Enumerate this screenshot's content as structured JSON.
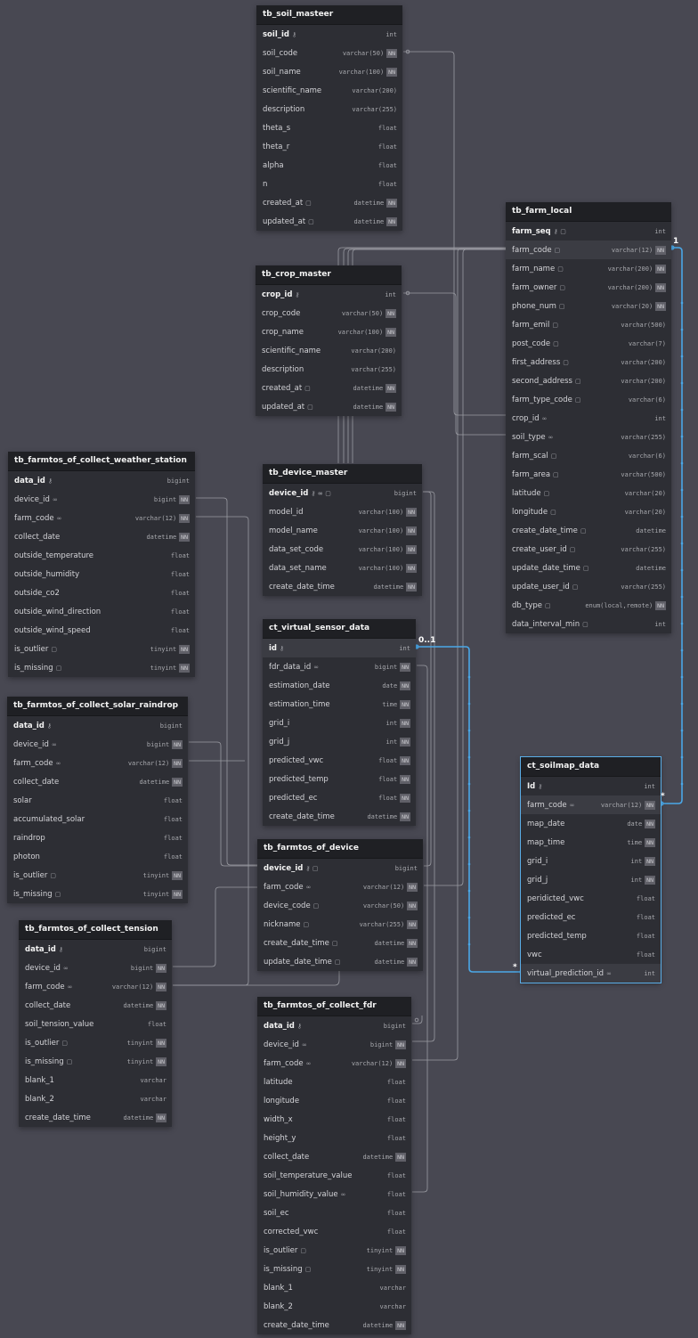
{
  "tables": [
    {
      "id": "tb_soil_masteer",
      "name": "tb_soil_masteer",
      "cols": [
        {
          "n": "soil_id",
          "t": "int",
          "pk": true,
          "ic": "key-icon"
        },
        {
          "n": "soil_code",
          "t": "varchar(50)",
          "nn": true
        },
        {
          "n": "soil_name",
          "t": "varchar(100)",
          "nn": true
        },
        {
          "n": "scientific_name",
          "t": "varchar(200)"
        },
        {
          "n": "description",
          "t": "varchar(255)"
        },
        {
          "n": "theta_s",
          "t": "float"
        },
        {
          "n": "theta_r",
          "t": "float"
        },
        {
          "n": "alpha",
          "t": "float"
        },
        {
          "n": "n",
          "t": "float"
        },
        {
          "n": "created_at",
          "t": "datetime",
          "nn": true,
          "ic": "note-icon"
        },
        {
          "n": "updated_at",
          "t": "datetime",
          "nn": true,
          "ic": "note-icon"
        }
      ]
    },
    {
      "id": "tb_crop_master",
      "name": "tb_crop_master",
      "cols": [
        {
          "n": "crop_id",
          "t": "int",
          "pk": true,
          "ic": "key-icon"
        },
        {
          "n": "crop_code",
          "t": "varchar(50)",
          "nn": true
        },
        {
          "n": "crop_name",
          "t": "varchar(100)",
          "nn": true
        },
        {
          "n": "scientific_name",
          "t": "varchar(200)"
        },
        {
          "n": "description",
          "t": "varchar(255)"
        },
        {
          "n": "created_at",
          "t": "datetime",
          "nn": true,
          "ic": "note-icon"
        },
        {
          "n": "updated_at",
          "t": "datetime",
          "nn": true,
          "ic": "note-icon"
        }
      ]
    },
    {
      "id": "tb_farm_local",
      "name": "tb_farm_local",
      "cols": [
        {
          "n": "farm_seq",
          "t": "int",
          "pk": true,
          "ic": "key-note-icon"
        },
        {
          "n": "farm_code",
          "t": "varchar(12)",
          "nn": true,
          "ic": "note-icon",
          "hi": true
        },
        {
          "n": "farm_name",
          "t": "varchar(200)",
          "nn": true,
          "ic": "note-icon"
        },
        {
          "n": "farm_owner",
          "t": "varchar(200)",
          "nn": true,
          "ic": "note-icon"
        },
        {
          "n": "phone_num",
          "t": "varchar(20)",
          "nn": true,
          "ic": "note-icon"
        },
        {
          "n": "farm_emil",
          "t": "varchar(500)",
          "ic": "note-icon"
        },
        {
          "n": "post_code",
          "t": "varchar(7)",
          "ic": "note-icon"
        },
        {
          "n": "first_address",
          "t": "varchar(200)",
          "ic": "note-icon"
        },
        {
          "n": "second_address",
          "t": "varchar(200)",
          "ic": "note-icon"
        },
        {
          "n": "farm_type_code",
          "t": "varchar(6)",
          "ic": "note-icon"
        },
        {
          "n": "crop_id",
          "t": "int",
          "ic": "link-icon"
        },
        {
          "n": "soil_type",
          "t": "varchar(255)",
          "ic": "link-icon"
        },
        {
          "n": "farm_scal",
          "t": "varchar(6)",
          "ic": "note-icon"
        },
        {
          "n": "farm_area",
          "t": "varchar(500)",
          "ic": "note-icon"
        },
        {
          "n": "latitude",
          "t": "varchar(20)",
          "ic": "note-icon"
        },
        {
          "n": "longitude",
          "t": "varchar(20)",
          "ic": "note-icon"
        },
        {
          "n": "create_date_time",
          "t": "datetime",
          "ic": "note-icon"
        },
        {
          "n": "create_user_id",
          "t": "varchar(255)",
          "ic": "note-icon"
        },
        {
          "n": "update_date_time",
          "t": "datetime",
          "ic": "note-icon"
        },
        {
          "n": "update_user_id",
          "t": "varchar(255)",
          "ic": "note-icon"
        },
        {
          "n": "db_type",
          "t": "enum(local,remote)",
          "nn": true,
          "ic": "note-icon"
        },
        {
          "n": "data_interval_min",
          "t": "int",
          "ic": "note-icon"
        }
      ]
    },
    {
      "id": "tb_farmtos_of_collect_weather_station",
      "name": "tb_farmtos_of_collect_weather_station",
      "cols": [
        {
          "n": "data_id",
          "t": "bigint",
          "pk": true,
          "ic": "key-icon"
        },
        {
          "n": "device_id",
          "t": "bigint",
          "nn": true,
          "ic": "link-icon"
        },
        {
          "n": "farm_code",
          "t": "varchar(12)",
          "nn": true,
          "ic": "link-icon"
        },
        {
          "n": "collect_date",
          "t": "datetime",
          "nn": true
        },
        {
          "n": "outside_temperature",
          "t": "float"
        },
        {
          "n": "outside_humidity",
          "t": "float"
        },
        {
          "n": "outside_co2",
          "t": "float"
        },
        {
          "n": "outside_wind_direction",
          "t": "float"
        },
        {
          "n": "outside_wind_speed",
          "t": "float"
        },
        {
          "n": "is_outlier",
          "t": "tinyint",
          "nn": true,
          "ic": "note-icon"
        },
        {
          "n": "is_missing",
          "t": "tinyint",
          "nn": true,
          "ic": "note-icon"
        }
      ]
    },
    {
      "id": "tb_device_master",
      "name": "tb_device_master",
      "cols": [
        {
          "n": "device_id",
          "t": "bigint",
          "pk": true,
          "ic": "key-link-note-icon"
        },
        {
          "n": "model_id",
          "t": "varchar(100)",
          "nn": true
        },
        {
          "n": "model_name",
          "t": "varchar(100)",
          "nn": true
        },
        {
          "n": "data_set_code",
          "t": "varchar(100)",
          "nn": true
        },
        {
          "n": "data_set_name",
          "t": "varchar(100)",
          "nn": true
        },
        {
          "n": "create_date_time",
          "t": "datetime",
          "nn": true
        }
      ]
    },
    {
      "id": "ct_virtual_sensor_data",
      "name": "ct_virtual_sensor_data",
      "cols": [
        {
          "n": "id",
          "t": "int",
          "pk": true,
          "ic": "key-icon",
          "hi": true
        },
        {
          "n": "fdr_data_id",
          "t": "bigint",
          "nn": true,
          "ic": "link-icon"
        },
        {
          "n": "estimation_date",
          "t": "date",
          "nn": true
        },
        {
          "n": "estimation_time",
          "t": "time",
          "nn": true
        },
        {
          "n": "grid_i",
          "t": "int",
          "nn": true
        },
        {
          "n": "grid_j",
          "t": "int",
          "nn": true
        },
        {
          "n": "predicted_vwc",
          "t": "float",
          "nn": true
        },
        {
          "n": "predicted_temp",
          "t": "float",
          "nn": true
        },
        {
          "n": "predicted_ec",
          "t": "float",
          "nn": true
        },
        {
          "n": "create_date_time",
          "t": "datetime",
          "nn": true
        }
      ]
    },
    {
      "id": "tb_farmtos_of_collect_solar_raindrop",
      "name": "tb_farmtos_of_collect_solar_raindrop",
      "cols": [
        {
          "n": "data_id",
          "t": "bigint",
          "pk": true,
          "ic": "key-icon"
        },
        {
          "n": "device_id",
          "t": "bigint",
          "nn": true,
          "ic": "link-icon"
        },
        {
          "n": "farm_code",
          "t": "varchar(12)",
          "nn": true,
          "ic": "link-icon"
        },
        {
          "n": "collect_date",
          "t": "datetime",
          "nn": true
        },
        {
          "n": "solar",
          "t": "float"
        },
        {
          "n": "accumulated_solar",
          "t": "float"
        },
        {
          "n": "raindrop",
          "t": "float"
        },
        {
          "n": "photon",
          "t": "float"
        },
        {
          "n": "is_outlier",
          "t": "tinyint",
          "nn": true,
          "ic": "note-icon"
        },
        {
          "n": "is_missing",
          "t": "tinyint",
          "nn": true,
          "ic": "note-icon"
        }
      ]
    },
    {
      "id": "ct_soilmap_data",
      "name": "ct_soilmap_data",
      "sel": true,
      "cols": [
        {
          "n": "Id",
          "t": "int",
          "pk": true,
          "ic": "key-icon"
        },
        {
          "n": "farm_code",
          "t": "varchar(12)",
          "nn": true,
          "ic": "link-icon",
          "hi": true
        },
        {
          "n": "map_date",
          "t": "date",
          "nn": true
        },
        {
          "n": "map_time",
          "t": "time",
          "nn": true
        },
        {
          "n": "grid_i",
          "t": "int",
          "nn": true
        },
        {
          "n": "grid_j",
          "t": "int",
          "nn": true
        },
        {
          "n": "peridicted_vwc",
          "t": "float"
        },
        {
          "n": "predicted_ec",
          "t": "float"
        },
        {
          "n": "predicted_temp",
          "t": "float"
        },
        {
          "n": "vwc",
          "t": "float"
        },
        {
          "n": "virtual_prediction_id",
          "t": "int",
          "ic": "link-icon",
          "hi": true
        }
      ]
    },
    {
      "id": "tb_farmtos_of_device",
      "name": "tb_farmtos_of_device",
      "cols": [
        {
          "n": "device_id",
          "t": "bigint",
          "pk": true,
          "ic": "key-note-icon"
        },
        {
          "n": "farm_code",
          "t": "varchar(12)",
          "nn": true,
          "ic": "link-icon"
        },
        {
          "n": "device_code",
          "t": "varchar(50)",
          "nn": true,
          "ic": "note-icon"
        },
        {
          "n": "nickname",
          "t": "varchar(255)",
          "nn": true,
          "ic": "note-icon"
        },
        {
          "n": "create_date_time",
          "t": "datetime",
          "nn": true,
          "ic": "note-icon"
        },
        {
          "n": "update_date_time",
          "t": "datetime",
          "nn": true,
          "ic": "note-icon"
        }
      ]
    },
    {
      "id": "tb_farmtos_of_collect_tension",
      "name": "tb_farmtos_of_collect_tension",
      "cols": [
        {
          "n": "data_id",
          "t": "bigint",
          "pk": true,
          "ic": "key-icon"
        },
        {
          "n": "device_id",
          "t": "bigint",
          "nn": true,
          "ic": "link-icon"
        },
        {
          "n": "farm_code",
          "t": "varchar(12)",
          "nn": true,
          "ic": "link-icon"
        },
        {
          "n": "collect_date",
          "t": "datetime",
          "nn": true
        },
        {
          "n": "soil_tension_value",
          "t": "float"
        },
        {
          "n": "is_outlier",
          "t": "tinyint",
          "nn": true,
          "ic": "note-icon"
        },
        {
          "n": "is_missing",
          "t": "tinyint",
          "nn": true,
          "ic": "note-icon"
        },
        {
          "n": "blank_1",
          "t": "varchar"
        },
        {
          "n": "blank_2",
          "t": "varchar"
        },
        {
          "n": "create_date_time",
          "t": "datetime",
          "nn": true
        }
      ]
    },
    {
      "id": "tb_farmtos_of_collect_fdr",
      "name": "tb_farmtos_of_collect_fdr",
      "cols": [
        {
          "n": "data_id",
          "t": "bigint",
          "pk": true,
          "ic": "key-icon"
        },
        {
          "n": "device_id",
          "t": "bigint",
          "nn": true,
          "ic": "link-icon"
        },
        {
          "n": "farm_code",
          "t": "varchar(12)",
          "nn": true,
          "ic": "link-icon"
        },
        {
          "n": "latitude",
          "t": "float"
        },
        {
          "n": "longitude",
          "t": "float"
        },
        {
          "n": "width_x",
          "t": "float"
        },
        {
          "n": "height_y",
          "t": "float"
        },
        {
          "n": "collect_date",
          "t": "datetime",
          "nn": true
        },
        {
          "n": "soil_temperature_value",
          "t": "float"
        },
        {
          "n": "soil_humidity_value",
          "t": "float",
          "ic": "link-icon"
        },
        {
          "n": "soil_ec",
          "t": "float"
        },
        {
          "n": "corrected_vwc",
          "t": "float"
        },
        {
          "n": "is_outlier",
          "t": "tinyint",
          "nn": true,
          "ic": "note-icon"
        },
        {
          "n": "is_missing",
          "t": "tinyint",
          "nn": true,
          "ic": "note-icon"
        },
        {
          "n": "blank_1",
          "t": "varchar"
        },
        {
          "n": "blank_2",
          "t": "varchar"
        },
        {
          "n": "create_date_time",
          "t": "datetime",
          "nn": true
        }
      ]
    }
  ],
  "not_null_label": "NN",
  "relation_labels": {
    "farm_one": "1",
    "farm_many": "*",
    "virtual_one": "0..1",
    "virtual_many": "*"
  },
  "colors": {
    "canvas": "#484852",
    "table_body": "#2d2e34",
    "table_header": "#1f2024",
    "link": "#9a9ba2",
    "highlight_link": "#4aa8e8"
  }
}
